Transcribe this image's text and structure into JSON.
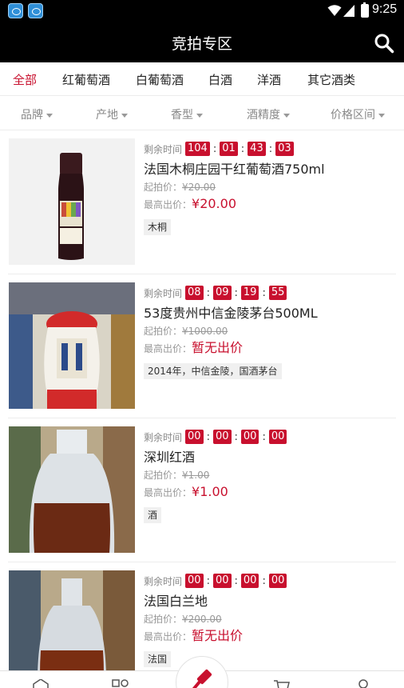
{
  "status_bar": {
    "time": "9:25"
  },
  "header": {
    "title": "竞拍专区"
  },
  "category_tabs": [
    {
      "label": "全部",
      "active": true
    },
    {
      "label": "红葡萄酒"
    },
    {
      "label": "白葡萄酒"
    },
    {
      "label": "白酒"
    },
    {
      "label": "洋酒"
    },
    {
      "label": "其它酒类"
    }
  ],
  "filters": [
    {
      "label": "品牌"
    },
    {
      "label": "产地"
    },
    {
      "label": "香型"
    },
    {
      "label": "酒精度"
    },
    {
      "label": "价格区间"
    }
  ],
  "labels": {
    "remaining": "剩余时间",
    "start_price": "起拍价：",
    "highest_bid": "最高出价："
  },
  "items": [
    {
      "countdown": [
        "104",
        "01",
        "43",
        "03"
      ],
      "name": "法国木桐庄园干红葡萄酒750ml",
      "start_price": "¥20.00",
      "highest_bid": "¥20.00",
      "tag": "木桐"
    },
    {
      "countdown": [
        "08",
        "09",
        "19",
        "55"
      ],
      "name": "53度贵州中信金陵茅台500ML",
      "start_price": "¥1000.00",
      "highest_bid": "暂无出价",
      "tag": "2014年，中信金陵，国酒茅台"
    },
    {
      "countdown": [
        "00",
        "00",
        "00",
        "00"
      ],
      "name": "深圳红酒",
      "start_price": "¥1.00",
      "highest_bid": "¥1.00",
      "tag": "酒"
    },
    {
      "countdown": [
        "00",
        "00",
        "00",
        "00"
      ],
      "name": "法国白兰地",
      "start_price": "¥200.00",
      "highest_bid": "暂无出价",
      "tag": "法国"
    }
  ],
  "colors": {
    "accent": "#c8102e",
    "header_bg": "#000000"
  }
}
